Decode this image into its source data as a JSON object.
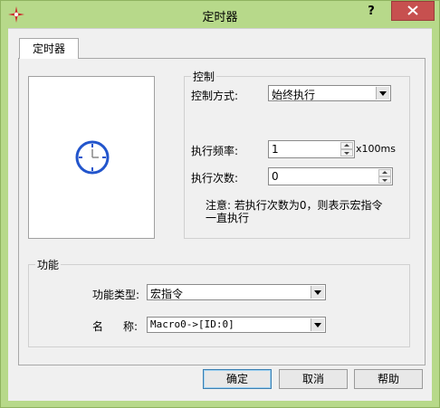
{
  "window": {
    "title": "定时器",
    "help_glyph": "?"
  },
  "tabs": [
    {
      "label": "定时器"
    }
  ],
  "control": {
    "legend": "控制",
    "mode_label": "控制方式:",
    "mode_value": "始终执行",
    "freq_label": "执行频率:",
    "freq_value": "1",
    "freq_unit": "x100ms",
    "count_label": "执行次数:",
    "count_value": "0",
    "note_line1": "注意: 若执行次数为0，则表示宏指令",
    "note_line2": "一直执行"
  },
  "function": {
    "legend": "功能",
    "type_label": "功能类型:",
    "type_value": "宏指令",
    "name_label_1": "名",
    "name_label_2": "称:",
    "name_value": "Macro0->[ID:0]"
  },
  "buttons": {
    "ok": "确定",
    "cancel": "取消",
    "help": "帮助"
  },
  "colors": {
    "titlebar": "#b7d98a",
    "close": "#c7504f",
    "clock": "#2255cc"
  }
}
